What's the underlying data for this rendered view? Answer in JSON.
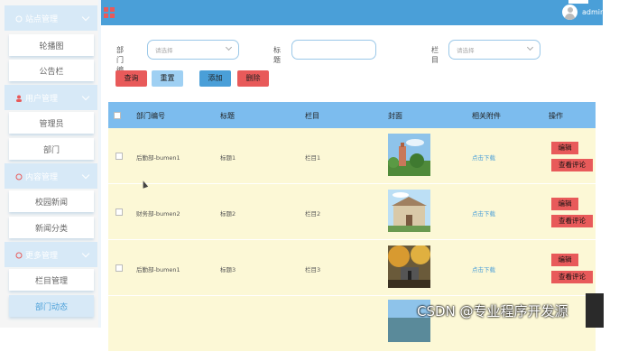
{
  "header": {
    "username": "admin"
  },
  "sidebar": {
    "groups": [
      {
        "label": "站点管理",
        "items": [
          "轮播图",
          "公告栏"
        ]
      },
      {
        "label": "用户管理",
        "items": [
          "管理员",
          "部门"
        ]
      },
      {
        "label": "内容管理",
        "items": [
          "校园新闻",
          "新闻分类"
        ]
      },
      {
        "label": "更多管理",
        "items": [
          "栏目管理",
          "部门动态"
        ]
      }
    ]
  },
  "filters": {
    "dept_label": "部门编号",
    "dept_placeholder": "请选择",
    "title_label": "标题",
    "title_value": "",
    "column_label": "栏目",
    "column_placeholder": "请选择"
  },
  "actions": {
    "query": "查询",
    "reset": "重置",
    "add": "添加",
    "delete": "删除"
  },
  "table": {
    "headers": [
      "部门编号",
      "标题",
      "栏目",
      "封面",
      "相关附件",
      "操作"
    ],
    "rows": [
      {
        "dept": "后勤部-bumen1",
        "title": "标题1",
        "column": "栏目1",
        "attachment": "点击下载",
        "edit": "编辑",
        "comments": "查看评论"
      },
      {
        "dept": "财务部-bumen2",
        "title": "标题2",
        "column": "栏目2",
        "attachment": "点击下载",
        "edit": "编辑",
        "comments": "查看评论"
      },
      {
        "dept": "后勤部-bumen1",
        "title": "标题3",
        "column": "栏目3",
        "attachment": "点击下载",
        "edit": "编辑",
        "comments": "查看评论"
      }
    ]
  },
  "watermark": "CSDN @专业程序开发源",
  "colors": {
    "primary": "#4a9fd8",
    "danger": "#e85a5a",
    "row_bg": "#fcf8d6",
    "header_bg": "#7cbcee"
  }
}
